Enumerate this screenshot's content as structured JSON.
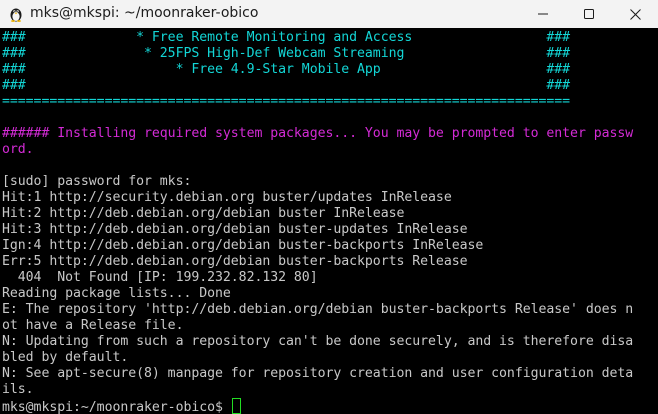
{
  "window": {
    "title": "mks@mkspi: ~/moonraker-obico",
    "icon": "penguin-icon",
    "controls": [
      "minimize-icon",
      "maximize-icon",
      "close-icon"
    ]
  },
  "terminal": {
    "colors": {
      "banner": "#13d6d6",
      "magenta": "#d42bd6",
      "text": "#c8c8c8",
      "cursor": "#22dd22"
    },
    "lines": [
      "###              * Free Remote Monitoring and Access                 ###",
      "###               * 25FPS High-Def Webcam Streaming                  ###",
      "###                   * Free 4.9-Star Mobile App                     ###",
      "###                                                                  ###",
      "========================================================================",
      "",
      "###### Installing required system packages... You may be prompted to enter passw",
      "ord.",
      "",
      "[sudo] password for mks:",
      "Hit:1 http://security.debian.org buster/updates InRelease",
      "Hit:2 http://deb.debian.org/debian buster InRelease",
      "Hit:3 http://deb.debian.org/debian buster-updates InRelease",
      "Ign:4 http://deb.debian.org/debian buster-backports InRelease",
      "Err:5 http://deb.debian.org/debian buster-backports Release",
      "  404  Not Found [IP: 199.232.82.132 80]",
      "Reading package lists... Done",
      "E: The repository 'http://deb.debian.org/debian buster-backports Release' does n",
      "ot have a Release file.",
      "N: Updating from such a repository can't be done securely, and is therefore disa",
      "bled by default.",
      "N: See apt-secure(8) manpage for repository creation and user configuration deta",
      "ils."
    ],
    "prompt": "mks@mkspi:~/moonraker-obico$ "
  }
}
